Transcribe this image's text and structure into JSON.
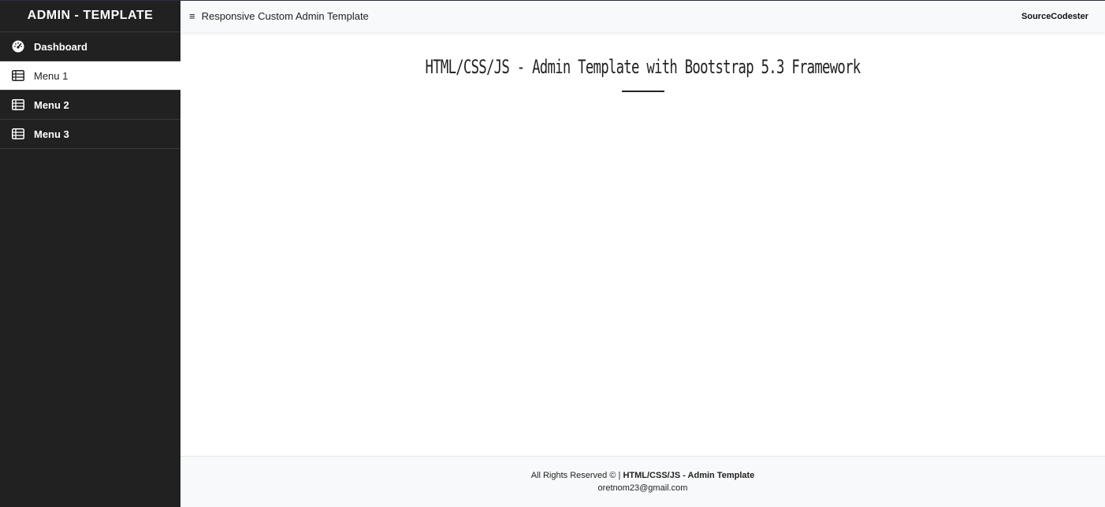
{
  "sidebar": {
    "brand": "ADMIN - TEMPLATE",
    "items": [
      {
        "label": "Dashboard",
        "icon": "dashboard-gauge-icon"
      },
      {
        "label": "Menu 1",
        "icon": "table-list-icon",
        "active": true
      },
      {
        "label": "Menu 2",
        "icon": "table-list-icon"
      },
      {
        "label": "Menu 3",
        "icon": "table-list-icon"
      }
    ]
  },
  "topbar": {
    "title": "Responsive Custom Admin Template",
    "right_label": "SourceCodester"
  },
  "main": {
    "heading": "HTML/CSS/JS - Admin Template with Bootstrap 5.3 Framework"
  },
  "footer": {
    "rights_prefix": "All Rights Reserved © |",
    "rights_bold": "HTML/CSS/JS - Admin Template",
    "email": "oretnom23@gmail.com"
  },
  "colors": {
    "sidebar_bg": "#212121",
    "active_item_bg": "#ffffff",
    "topbar_bg": "#f8f9fa",
    "footer_bg": "#f8f9fa"
  }
}
